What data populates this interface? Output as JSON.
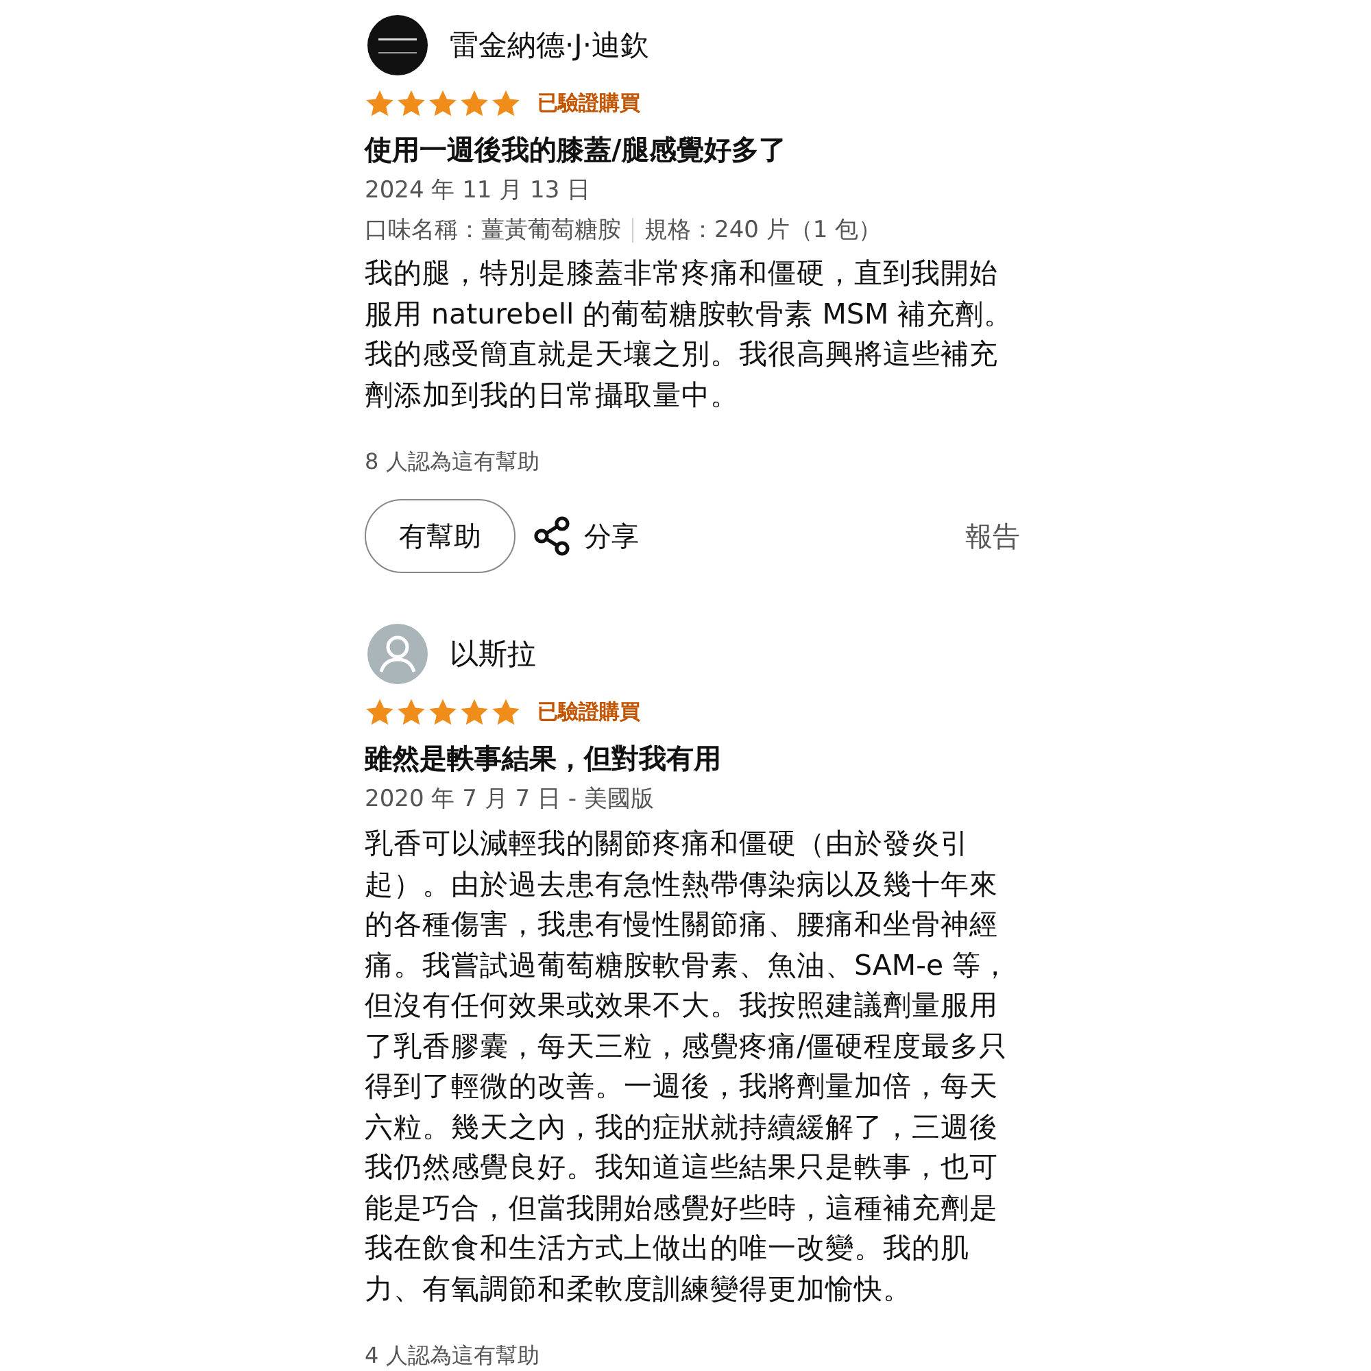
{
  "reviews": [
    {
      "reviewer": "雷金納德·J·迪欽",
      "default_avatar": false,
      "stars": 5,
      "badge": "已驗證購買",
      "title": "使用一週後我的膝蓋/腿感覺好多了",
      "date": "2024 年 11 月 13 日",
      "variant": [
        {
          "label": "口味名稱：薑黃葡萄糖胺"
        },
        {
          "label": "規格：240 片（1 包）"
        }
      ],
      "body": "我的腿，特別是膝蓋非常疼痛和僵硬，直到我開始服用 naturebell 的葡萄糖胺軟骨素 MSM 補充劑。我的感受簡直就是天壤之別。我很高興將這些補充劑添加到我的日常攝取量中。",
      "helpful_count": "8 人認為這有幫助",
      "actions": {
        "helpful": "有幫助",
        "share": "分享",
        "report": "報告"
      }
    },
    {
      "reviewer": "以斯拉",
      "default_avatar": true,
      "stars": 5,
      "badge": "已驗證購買",
      "title": "雖然是軼事結果，但對我有用",
      "date": "2020 年 7 月 7 日 - 美國版",
      "body": "乳香可以減輕我的關節疼痛和僵硬（由於發炎引起）。由於過去患有急性熱帶傳染病以及幾十年來的各種傷害，我患有慢性關節痛、腰痛和坐骨神經痛。我嘗試過葡萄糖胺軟骨素、魚油、SAM-e 等，但沒有任何效果或效果不大。我按照建議劑量服用了乳香膠囊，每天三粒，感覺疼痛/僵硬程度最多只得到了輕微的改善。一週後，我將劑量加倍，每天六粒。幾天之內，我的症狀就持續緩解了，三週後我仍然感覺良好。我知道這些結果只是軼事，也可能是巧合，但當我開始感覺好些時，這種補充劑是我在飲食和生活方式上做出的唯一改變。我的肌力、有氧調節和柔軟度訓練變得更加愉快。",
      "helpful_count": "4 人認為這有幫助"
    }
  ]
}
